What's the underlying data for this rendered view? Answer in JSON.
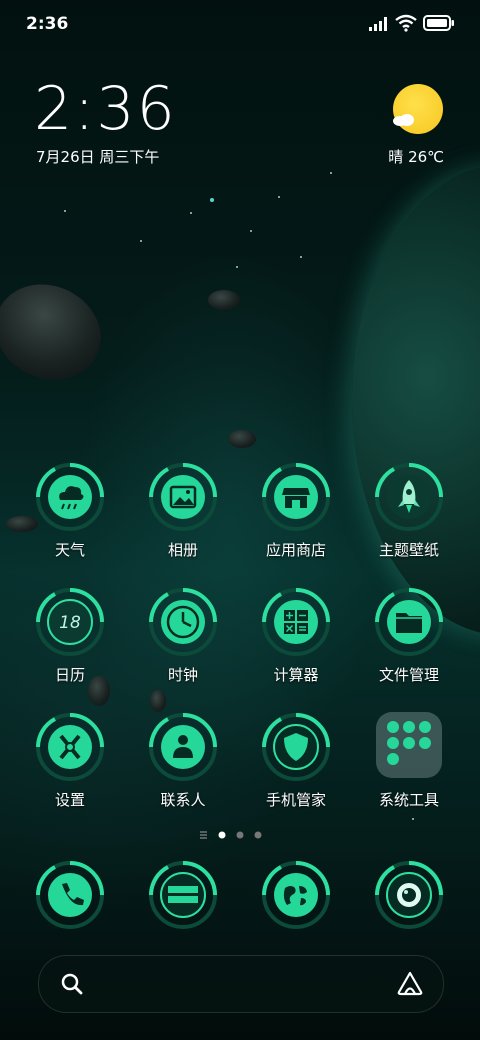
{
  "status_bar": {
    "time": "2:36"
  },
  "clock_widget": {
    "time": "2:36",
    "date": "7月26日 周三下午",
    "weather": "晴 26℃"
  },
  "apps": [
    {
      "label": "天气",
      "icon": "cloud-rain-icon"
    },
    {
      "label": "相册",
      "icon": "image-icon"
    },
    {
      "label": "应用商店",
      "icon": "store-icon"
    },
    {
      "label": "主题壁纸",
      "icon": "rocket-icon"
    },
    {
      "label": "日历",
      "icon": "calendar-18-icon",
      "icon_text": "18"
    },
    {
      "label": "时钟",
      "icon": "clock-icon"
    },
    {
      "label": "计算器",
      "icon": "calculator-icon"
    },
    {
      "label": "文件管理",
      "icon": "folder-icon"
    },
    {
      "label": "设置",
      "icon": "gear-icon"
    },
    {
      "label": "联系人",
      "icon": "contacts-icon"
    },
    {
      "label": "手机管家",
      "icon": "shield-icon"
    },
    {
      "label": "系统工具",
      "icon": "folder-group-icon"
    }
  ],
  "dock": [
    {
      "icon": "phone-icon"
    },
    {
      "icon": "messages-icon"
    },
    {
      "icon": "browser-globe-icon"
    },
    {
      "icon": "camera-icon"
    }
  ],
  "page_indicator": {
    "pages": 3,
    "current": 1
  },
  "colors": {
    "accent": "#2ee0a0",
    "accent_dark": "#0a7a58",
    "sun": "#f6c620"
  }
}
